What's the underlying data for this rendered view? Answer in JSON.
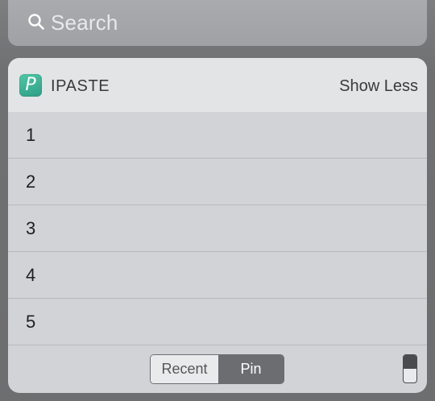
{
  "search": {
    "placeholder": "Search",
    "icon": "search-icon"
  },
  "widget": {
    "app_icon_letter": "P",
    "app_name": "IPASTE",
    "show_less_label": "Show Less",
    "items": [
      {
        "label": "1"
      },
      {
        "label": "2"
      },
      {
        "label": "3"
      },
      {
        "label": "4"
      },
      {
        "label": "5"
      }
    ],
    "tabs": {
      "recent_label": "Recent",
      "pin_label": "Pin",
      "selected": "Pin"
    },
    "colors": {
      "app_icon_accent": "#3fb598",
      "selected_segment": "#6b6d70"
    }
  }
}
